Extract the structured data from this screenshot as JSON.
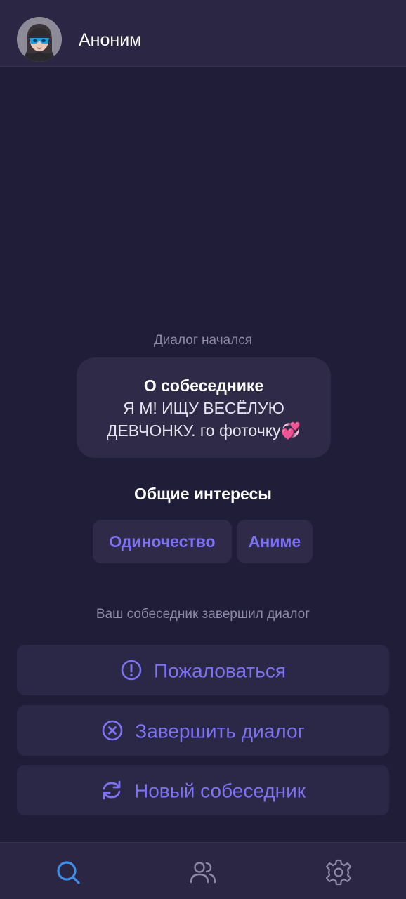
{
  "header": {
    "username": "Аноним",
    "avatar_icon": "masked-girl-avatar"
  },
  "chat": {
    "dialog_started": "Диалог начался",
    "about": {
      "title": "О собеседнике",
      "text": "Я М! ИЩУ  ВЕСЁЛУЮ\nДЕВЧОНКУ. го фоточку💞"
    },
    "interests_title": "Общие интересы",
    "interests": [
      "Одиночество",
      "Аниме"
    ],
    "ended_text": "Ваш собеседник завершил диалог"
  },
  "actions": {
    "report": {
      "label": "Пожаловаться",
      "icon": "exclamation-circle-icon"
    },
    "end": {
      "label": "Завершить диалог",
      "icon": "x-circle-icon"
    },
    "new": {
      "label": "Новый собеседник",
      "icon": "refresh-icon"
    }
  },
  "tabbar": {
    "tabs": [
      {
        "icon": "search-icon",
        "active": true
      },
      {
        "icon": "users-icon",
        "active": false
      },
      {
        "icon": "gear-icon",
        "active": false
      }
    ]
  },
  "colors": {
    "background": "#201d38",
    "panel": "#2a2644",
    "accent": "#7d72f2",
    "muted": "#8d89a6",
    "active_tab": "#3f8fe8"
  }
}
